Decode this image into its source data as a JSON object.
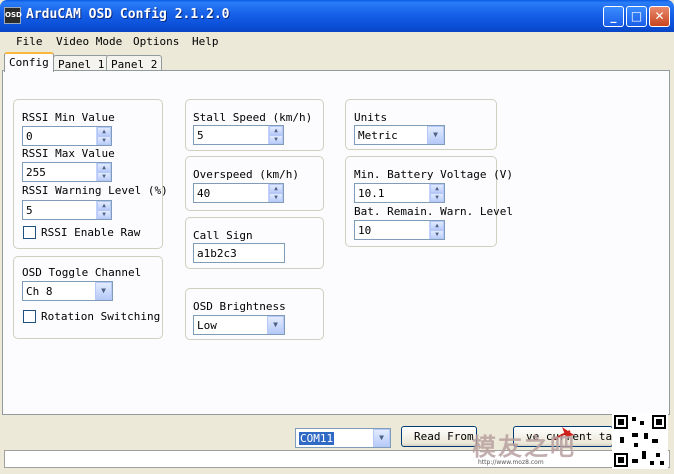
{
  "window": {
    "title": "ArduCAM OSD Config 2.1.2.0",
    "icon_text": "OSD",
    "minimize": "_",
    "maximize": "□",
    "close": "✕"
  },
  "menu": [
    "File",
    "Video Mode",
    "Options",
    "Help"
  ],
  "tabs": [
    "Config",
    "Panel 1",
    "Panel 2"
  ],
  "rssi": {
    "min_label": "RSSI Min Value",
    "min_value": "0",
    "max_label": "RSSI Max Value",
    "max_value": "255",
    "warn_label": "RSSI Warning Level (%)",
    "warn_value": "5",
    "enable_raw_label": "RSSI Enable Raw"
  },
  "toggle": {
    "channel_label": "OSD Toggle Channel",
    "channel_value": "Ch 8",
    "rotation_label": "Rotation Switching"
  },
  "speed": {
    "stall_label": "Stall Speed (km/h)",
    "stall_value": "5",
    "overspeed_label": "Overspeed (km/h)",
    "overspeed_value": "40"
  },
  "callsign": {
    "label": "Call Sign",
    "value": "a1b2c3"
  },
  "brightness": {
    "label": "OSD Brightness",
    "value": "Low"
  },
  "units": {
    "label": "Units",
    "value": "Metric"
  },
  "battery": {
    "min_voltage_label": "Min. Battery Voltage (V)",
    "min_voltage_value": "10.1",
    "remain_warn_label": "Bat. Remain. Warn. Level",
    "remain_warn_value": "10"
  },
  "bottom": {
    "com_port": "COM11",
    "read_button": "Read From",
    "save_button": "ve current ta"
  },
  "watermark": {
    "text": "模友之吧",
    "url": "http://www.moz8.com"
  },
  "colors": {
    "title_blue": "#0b4fd8",
    "tab_highlight": "#f9b73e",
    "panel_bg": "#fcfcfe"
  }
}
